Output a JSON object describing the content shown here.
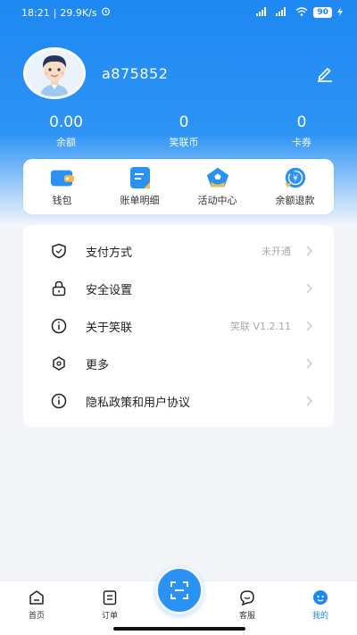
{
  "status_bar": {
    "time": "18:21",
    "speed": "29.9K/s",
    "battery": "90"
  },
  "profile": {
    "username": "a875852"
  },
  "stats": [
    {
      "value": "0.00",
      "label": "余额"
    },
    {
      "value": "0",
      "label": "笑联币"
    },
    {
      "value": "0",
      "label": "卡券"
    }
  ],
  "quick_actions": [
    {
      "label": "钱包",
      "icon": "wallet-icon"
    },
    {
      "label": "账单明细",
      "icon": "bill-icon"
    },
    {
      "label": "活动中心",
      "icon": "activity-icon"
    },
    {
      "label": "余额退款",
      "icon": "refund-icon"
    }
  ],
  "menu": [
    {
      "label": "支付方式",
      "value": "未开通",
      "icon": "shield-icon"
    },
    {
      "label": "安全设置",
      "value": "",
      "icon": "lock-icon"
    },
    {
      "label": "关于笑联",
      "value": "笑联 V1.2.11",
      "icon": "info-icon"
    },
    {
      "label": "更多",
      "value": "",
      "icon": "hexagon-icon"
    },
    {
      "label": "隐私政策和用户协议",
      "value": "",
      "icon": "info-icon"
    }
  ],
  "tabbar": {
    "home": "首页",
    "orders": "订单",
    "service": "客服",
    "mine": "我的"
  },
  "colors": {
    "accent": "#1e88f2",
    "background": "#f3f5f9"
  }
}
